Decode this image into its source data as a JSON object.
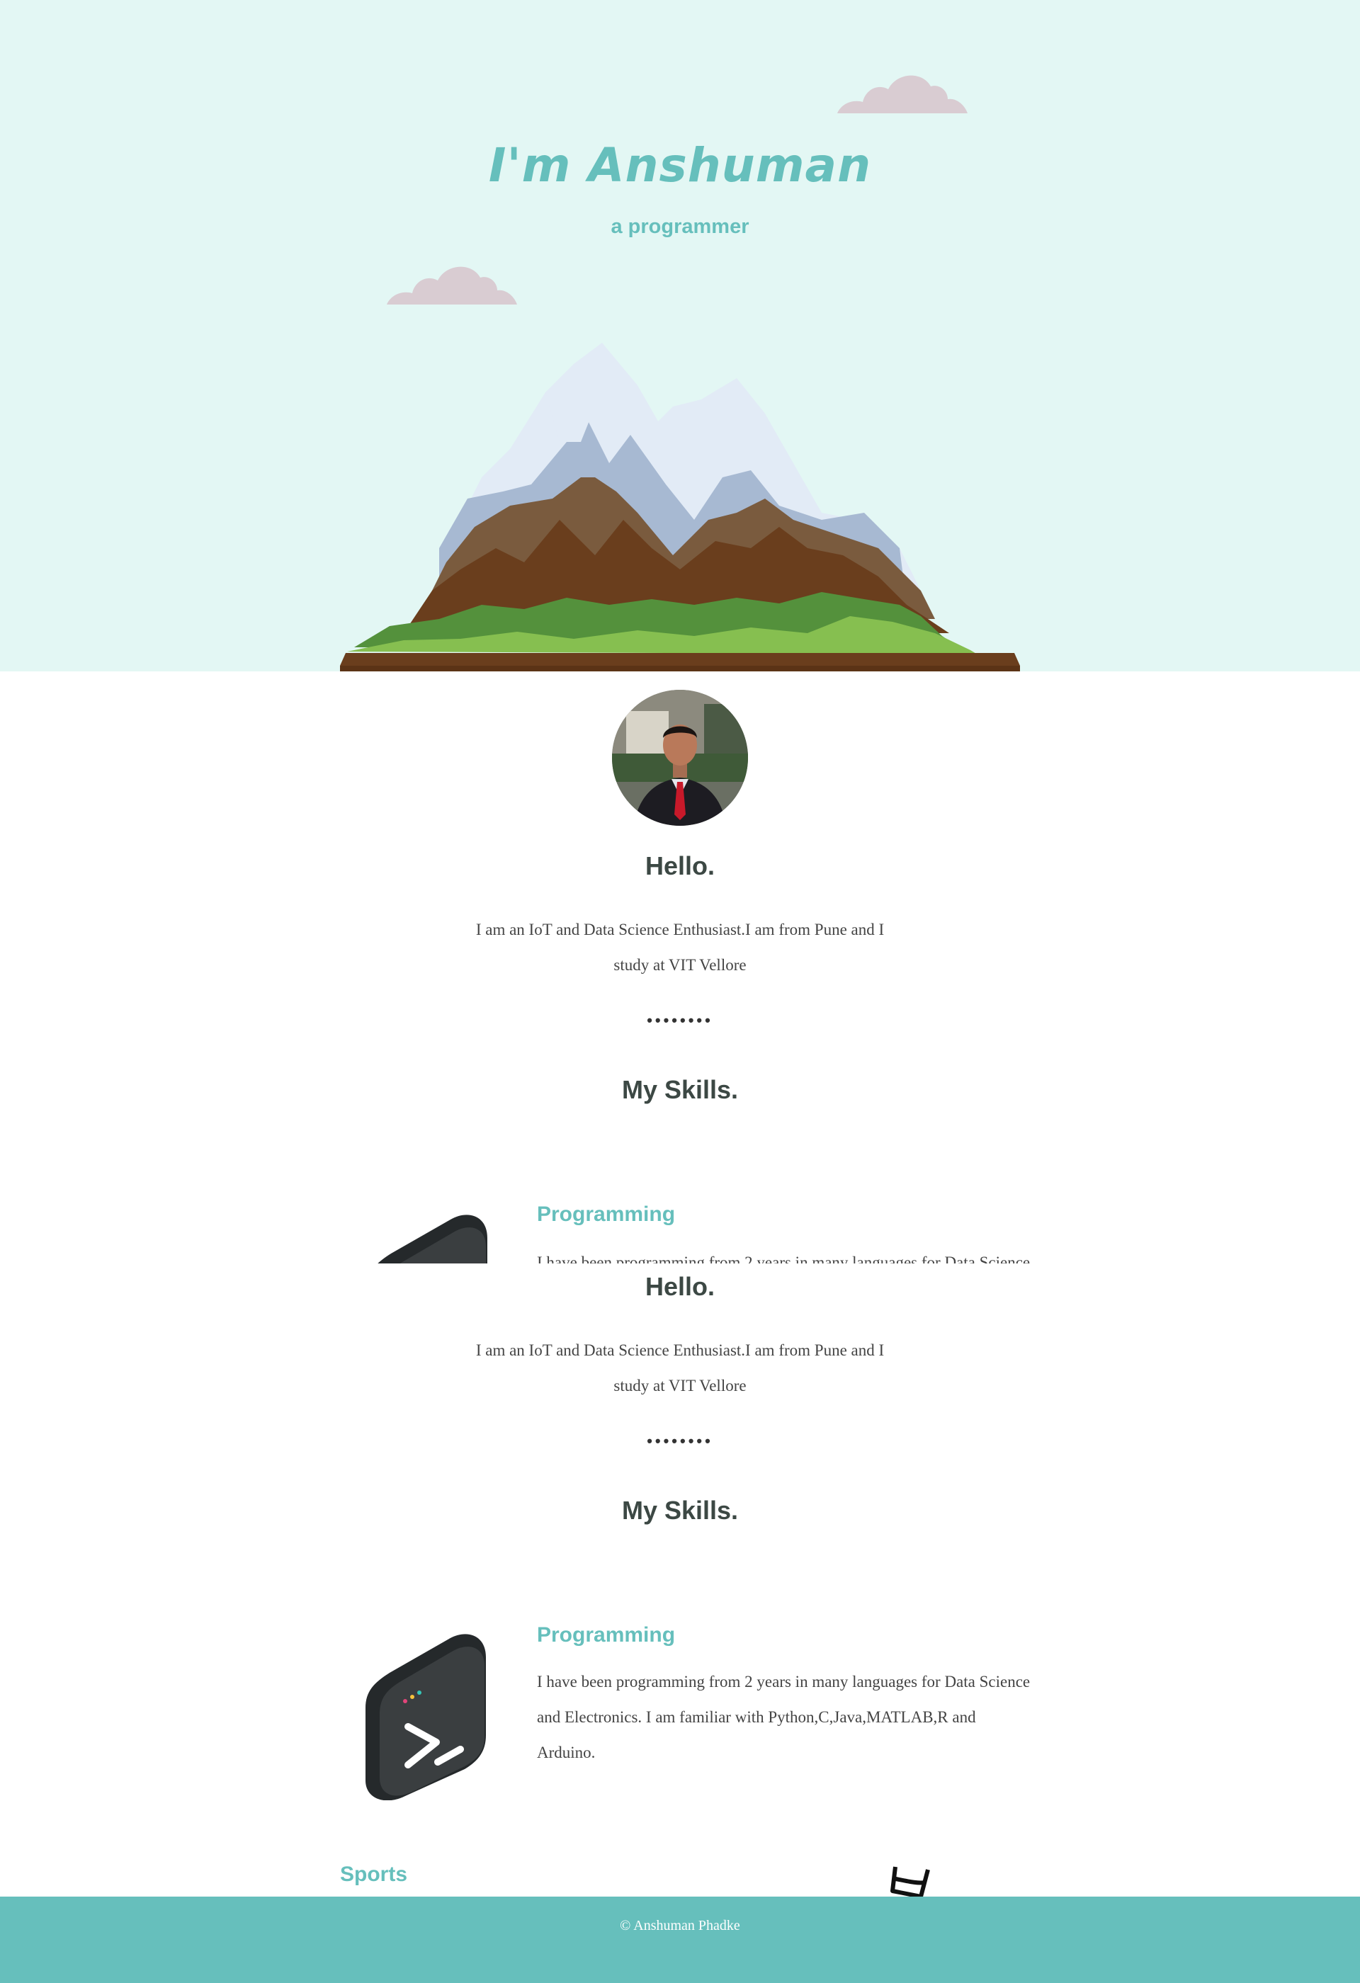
{
  "hero": {
    "title": "I'm Anshuman",
    "subtitle": "a programmer"
  },
  "intro": {
    "heading": "Hello.",
    "text": "I am an IoT and Data Science Enthusiast.I am from Pune and I study at VIT Vellore",
    "divider": "••••••••"
  },
  "skills": {
    "heading": "My Skills.",
    "items": [
      {
        "title": "Programming",
        "text": "I have been programming from 2 years in many languages for Data Science and Electronics. I am familiar with Python,C,Java,MATLAB,R and Arduino.",
        "icon": "terminal-icon"
      },
      {
        "title": "Sports",
        "icon": "barbell-icon"
      }
    ]
  },
  "footer": {
    "copyright": "© Anshuman Phadke"
  },
  "colors": {
    "accent": "#66bfbc",
    "hero_background": "#e3f7f4",
    "heading_text": "#3c4844",
    "body_text": "#444444",
    "cloud": "#d9ccd2"
  }
}
